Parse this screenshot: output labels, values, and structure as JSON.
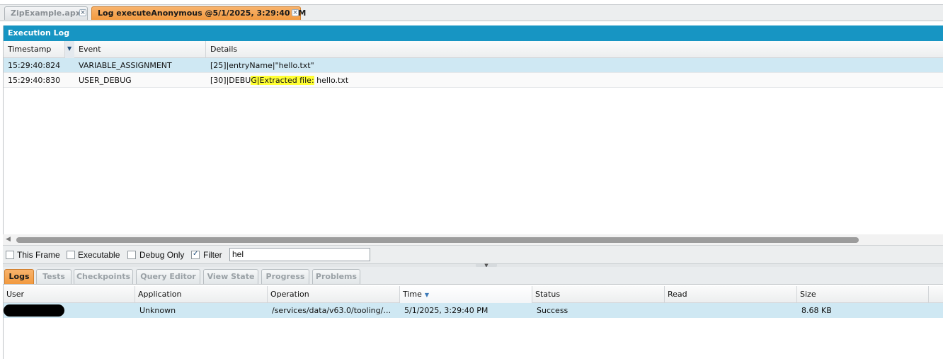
{
  "file_tabs": [
    {
      "label": "ZipExample.apxc",
      "active": false
    },
    {
      "label": "Log executeAnonymous @5/1/2025, 3:29:40 PM",
      "active": true
    }
  ],
  "execution_log": {
    "title": "Execution Log",
    "columns": [
      "Timestamp",
      "Event",
      "Details"
    ],
    "rows": [
      {
        "timestamp": "15:29:40:824",
        "event": "VARIABLE_ASSIGNMENT",
        "details": "[25]|entryName|\"hello.txt\""
      },
      {
        "timestamp": "15:29:40:830",
        "event": "USER_DEBUG",
        "details_pre": "[30]|DEBU",
        "details_hl": "G|Extracted file:",
        "details_post": " hello.txt"
      }
    ]
  },
  "filters": {
    "this_frame": {
      "label": "This Frame",
      "checked": false
    },
    "executable": {
      "label": "Executable",
      "checked": false
    },
    "debug_only": {
      "label": "Debug Only",
      "checked": false
    },
    "filter": {
      "label": "Filter",
      "checked": true,
      "value": "hel"
    }
  },
  "bottom_tabs": [
    "Logs",
    "Tests",
    "Checkpoints",
    "Query Editor",
    "View State",
    "Progress",
    "Problems"
  ],
  "logs_table": {
    "columns": [
      "User",
      "Application",
      "Operation",
      "Time",
      "Status",
      "Read",
      "Size"
    ],
    "rows": [
      {
        "user": "",
        "application": "Unknown",
        "operation": "/services/data/v63.0/tooling/exec...",
        "time": "5/1/2025, 3:29:40 PM",
        "status": "Success",
        "read": "",
        "size": "8.68 KB"
      }
    ]
  }
}
